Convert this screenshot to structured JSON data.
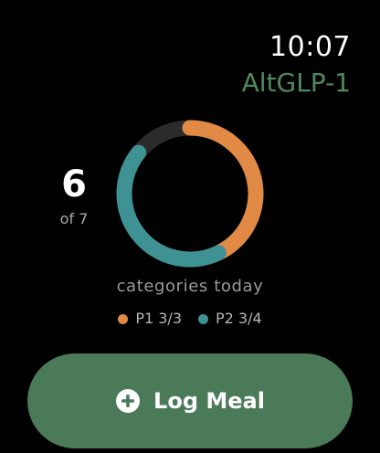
{
  "status": {
    "time": "10:07"
  },
  "app": {
    "title": "AltGLP-1"
  },
  "progress": {
    "count": "6",
    "total_label": "of 7",
    "caption": "categories today",
    "track_color": "#2b2b2b"
  },
  "legend": [
    {
      "label": "P1 3/3",
      "color": "#e08a46"
    },
    {
      "label": "P2 3/4",
      "color": "#3f9294"
    }
  ],
  "chart_data": {
    "type": "pie",
    "categories": [
      "P1",
      "P2",
      "Remaining"
    ],
    "values": [
      3,
      3,
      1
    ],
    "colors": [
      "#e08a46",
      "#3f9294",
      "#2b2b2b"
    ],
    "total": 7
  },
  "action": {
    "label": "Log Meal",
    "icon": "plus-circle-icon",
    "color": "#4a7a57"
  }
}
